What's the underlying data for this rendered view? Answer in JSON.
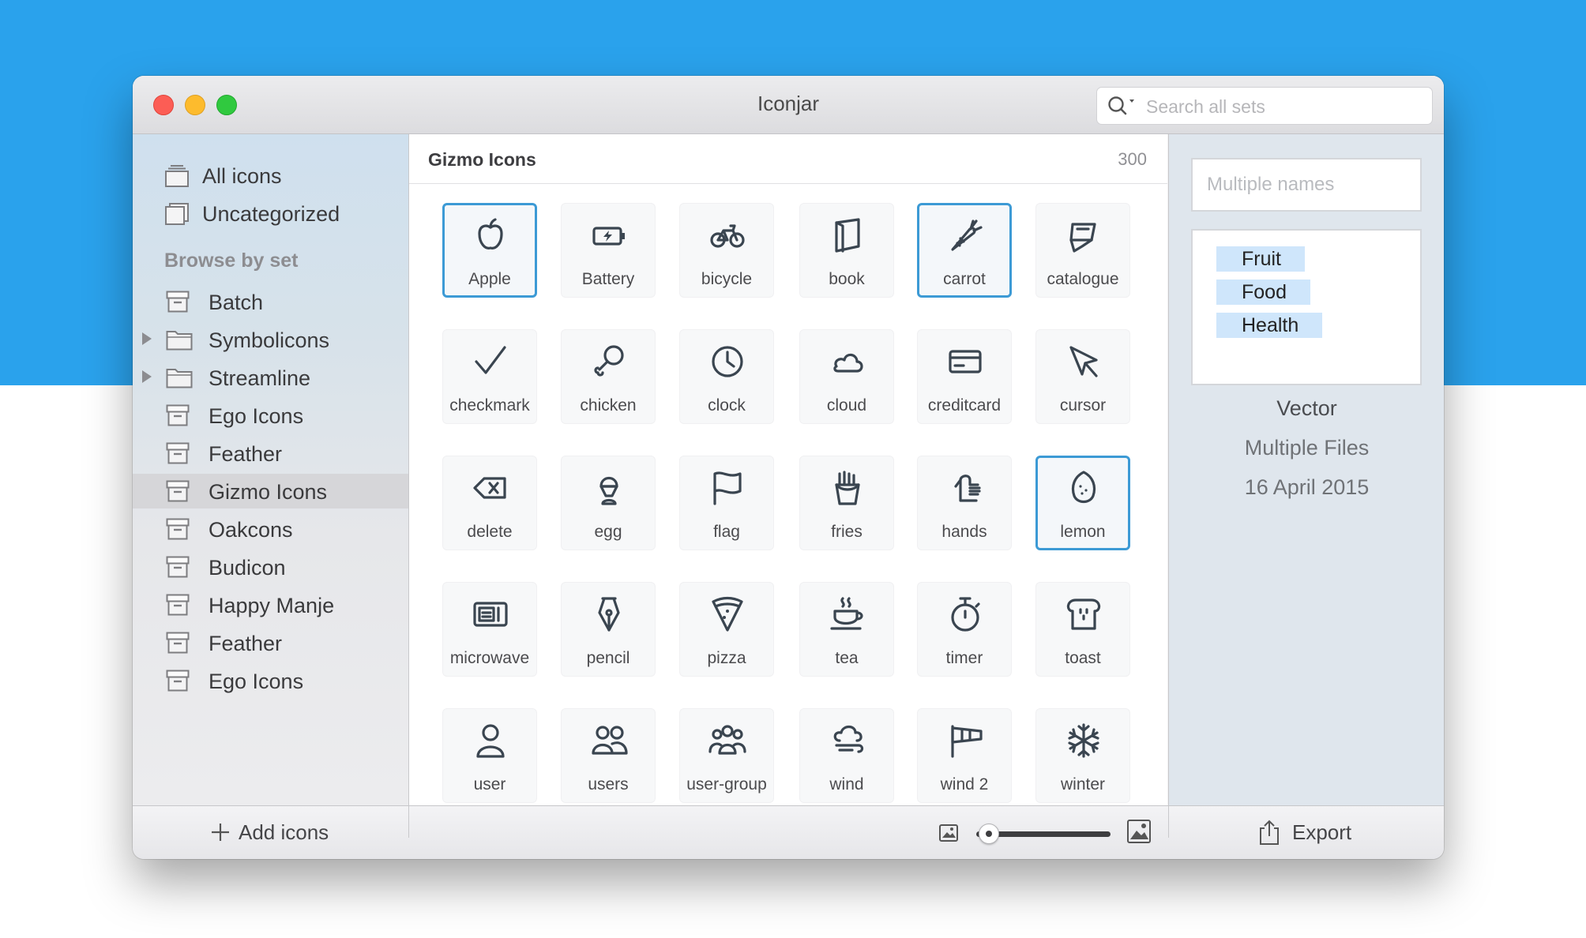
{
  "window": {
    "title": "Iconjar"
  },
  "search": {
    "placeholder": "Search all sets"
  },
  "sidebar": {
    "top_items": [
      {
        "label": "All icons"
      },
      {
        "label": "Uncategorized"
      }
    ],
    "heading": "Browse by set",
    "sets": [
      {
        "label": "Batch",
        "type": "archive"
      },
      {
        "label": "Symbolicons",
        "type": "folder",
        "expandable": true
      },
      {
        "label": "Streamline",
        "type": "folder",
        "expandable": true
      },
      {
        "label": "Ego Icons",
        "type": "archive"
      },
      {
        "label": "Feather",
        "type": "archive"
      },
      {
        "label": "Gizmo Icons",
        "type": "archive",
        "selected": true
      },
      {
        "label": "Oakcons",
        "type": "archive"
      },
      {
        "label": "Budicon",
        "type": "archive"
      },
      {
        "label": "Happy Manje",
        "type": "archive"
      },
      {
        "label": "Feather",
        "type": "archive"
      },
      {
        "label": "Ego Icons",
        "type": "archive"
      }
    ]
  },
  "main": {
    "set_name": "Gizmo Icons",
    "count": "300",
    "icons": [
      {
        "label": "Apple",
        "icon": "apple-icon",
        "selected": true
      },
      {
        "label": "Battery",
        "icon": "battery-icon"
      },
      {
        "label": "bicycle",
        "icon": "bicycle-icon"
      },
      {
        "label": "book",
        "icon": "book-icon"
      },
      {
        "label": "carrot",
        "icon": "carrot-icon",
        "selected": true
      },
      {
        "label": "catalogue",
        "icon": "catalogue-icon"
      },
      {
        "label": "checkmark",
        "icon": "checkmark-icon"
      },
      {
        "label": "chicken",
        "icon": "chicken-icon"
      },
      {
        "label": "clock",
        "icon": "clock-icon"
      },
      {
        "label": "cloud",
        "icon": "cloud-icon"
      },
      {
        "label": "creditcard",
        "icon": "creditcard-icon"
      },
      {
        "label": "cursor",
        "icon": "cursor-icon"
      },
      {
        "label": "delete",
        "icon": "delete-icon"
      },
      {
        "label": "egg",
        "icon": "egg-icon"
      },
      {
        "label": "flag",
        "icon": "flag-icon"
      },
      {
        "label": "fries",
        "icon": "fries-icon"
      },
      {
        "label": "hands",
        "icon": "hands-icon"
      },
      {
        "label": "lemon",
        "icon": "lemon-icon",
        "selected": true
      },
      {
        "label": "microwave",
        "icon": "microwave-icon"
      },
      {
        "label": "pencil",
        "icon": "pencil-icon"
      },
      {
        "label": "pizza",
        "icon": "pizza-icon"
      },
      {
        "label": "tea",
        "icon": "tea-icon"
      },
      {
        "label": "timer",
        "icon": "timer-icon"
      },
      {
        "label": "toast",
        "icon": "toast-icon"
      },
      {
        "label": "user",
        "icon": "user-icon"
      },
      {
        "label": "users",
        "icon": "users-icon"
      },
      {
        "label": "user-group",
        "icon": "user-group-icon"
      },
      {
        "label": "wind",
        "icon": "wind-icon"
      },
      {
        "label": "wind 2",
        "icon": "wind-2-icon"
      },
      {
        "label": "winter",
        "icon": "winter-icon"
      }
    ]
  },
  "inspector": {
    "names_placeholder": "Multiple names",
    "tags": [
      "Fruit",
      "Food",
      "Health"
    ],
    "type": "Vector",
    "files": "Multiple Files",
    "date": "16 April 2015"
  },
  "bottom": {
    "add_label": "Add icons",
    "export_label": "Export",
    "icon_size_level": 0.05
  },
  "colors": {
    "background": "#2aa2ec",
    "selection": "#3c9ad5",
    "tag_bg": "#cfe6fb",
    "icon_stroke": "#3a4550"
  }
}
